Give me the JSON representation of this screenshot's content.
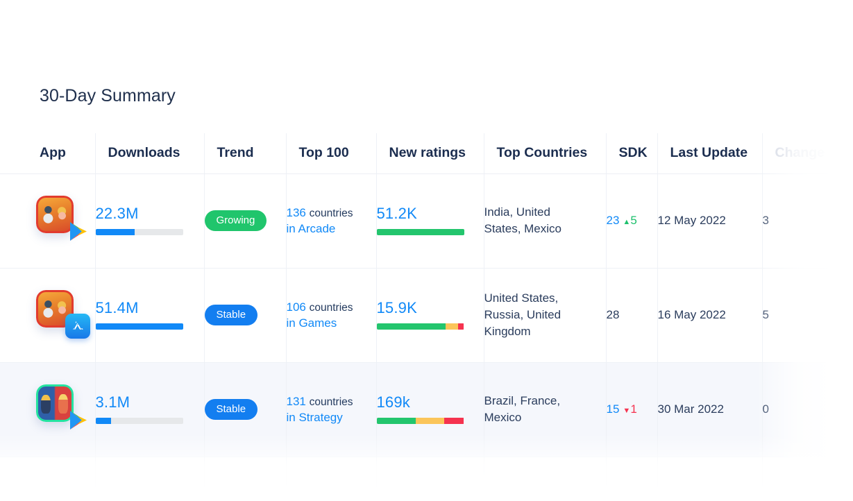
{
  "card": {
    "title": "30-Day Summary"
  },
  "table": {
    "columns": [
      {
        "key": "app",
        "label": "App"
      },
      {
        "key": "downloads",
        "label": "Downloads"
      },
      {
        "key": "trend",
        "label": "Trend"
      },
      {
        "key": "top100",
        "label": "Top 100"
      },
      {
        "key": "ratings",
        "label": "New ratings"
      },
      {
        "key": "countries",
        "label": "Top Countries"
      },
      {
        "key": "sdk",
        "label": "SDK"
      },
      {
        "key": "update",
        "label": "Last Update"
      },
      {
        "key": "change",
        "label": "Change"
      }
    ],
    "rows": [
      {
        "app": {
          "icon": "subway-surfers-app-icon",
          "store_badge": "google-play-badge-icon"
        },
        "downloads": {
          "value": "22.3M",
          "bar_percent": 45
        },
        "trend": {
          "label": "Growing",
          "style": "growing"
        },
        "top100": {
          "count": "136",
          "unit": "countries",
          "category": "in Arcade"
        },
        "ratings": {
          "value": "51.2K",
          "segments": [
            {
              "color": "#23c56d",
              "percent": 100
            },
            {
              "color": "#fbc55a",
              "percent": 0
            },
            {
              "color": "#f5334f",
              "percent": 0
            }
          ]
        },
        "countries": "India, United States, Mexico",
        "sdk": {
          "value": "23",
          "delta": "5",
          "direction": "up"
        },
        "update": "12 May 2022",
        "change": "3"
      },
      {
        "app": {
          "icon": "subway-surfers-app-icon",
          "store_badge": "app-store-badge-icon"
        },
        "downloads": {
          "value": "51.4M",
          "bar_percent": 100
        },
        "trend": {
          "label": "Stable",
          "style": "stable"
        },
        "top100": {
          "count": "106",
          "unit": "countries",
          "category": "in Games"
        },
        "ratings": {
          "value": "15.9K",
          "segments": [
            {
              "color": "#23c56d",
              "percent": 79
            },
            {
              "color": "#fbc55a",
              "percent": 14
            },
            {
              "color": "#f5334f",
              "percent": 7
            }
          ]
        },
        "countries": "United States, Russia, United Kingdom",
        "sdk": {
          "value": "28",
          "delta": "",
          "direction": "none"
        },
        "update": "16 May 2022",
        "change": "5"
      },
      {
        "app": {
          "icon": "clash-royale-app-icon",
          "store_badge": "google-play-badge-icon"
        },
        "downloads": {
          "value": "3.1M",
          "bar_percent": 18
        },
        "trend": {
          "label": "Stable",
          "style": "stable"
        },
        "top100": {
          "count": "131",
          "unit": "countries",
          "category": "in Strategy"
        },
        "ratings": {
          "value": "169k",
          "segments": [
            {
              "color": "#23c56d",
              "percent": 45
            },
            {
              "color": "#fbc55a",
              "percent": 32
            },
            {
              "color": "#f5334f",
              "percent": 23
            }
          ]
        },
        "countries": "Brazil, France, Mexico",
        "sdk": {
          "value": "15",
          "delta": "1",
          "direction": "down"
        },
        "update": "30 Mar 2022",
        "change": "0"
      }
    ]
  },
  "colors": {
    "accent_blue": "#1189f7",
    "pill_green": "#20c56c",
    "pill_blue": "#137ef0",
    "rating_green": "#23c56d",
    "rating_yellow": "#fbc55a",
    "rating_red": "#f5334f",
    "heading_navy": "#1b2d4f",
    "row_highlight": "#f5f7fc",
    "muted_header": "#c9cfdd"
  },
  "glyphs": {
    "triangle_up": "▲",
    "triangle_down": "▼"
  }
}
